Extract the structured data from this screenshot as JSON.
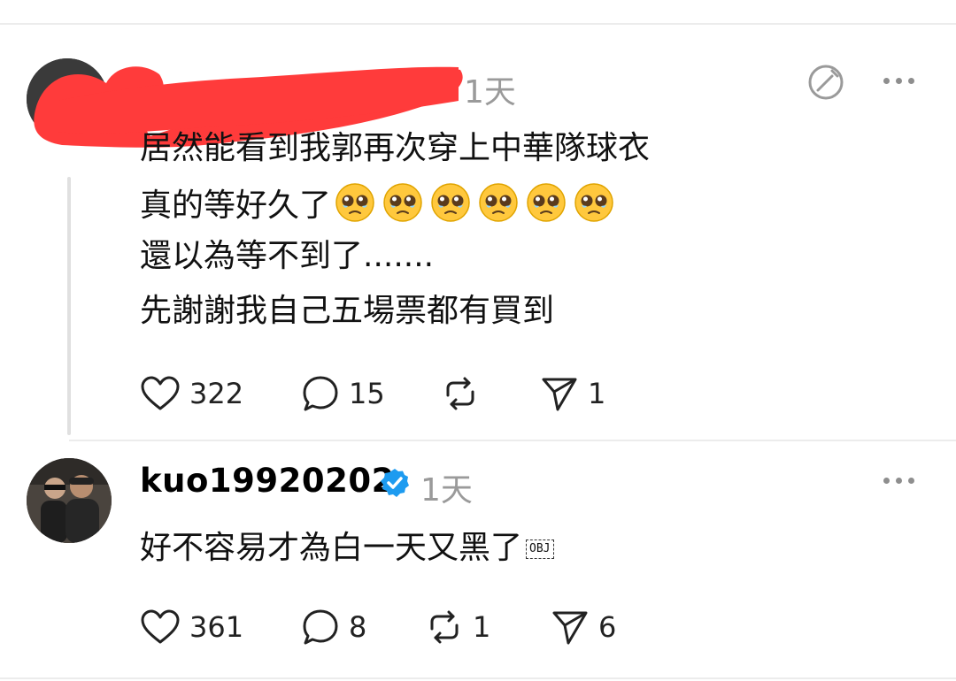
{
  "post1": {
    "timestamp": "1天",
    "lines": [
      "居然能看到我郭再次穿上中華隊球衣",
      "真的等好久了",
      "還以為等不到了.......",
      "先謝謝我自己五場票都有買到"
    ],
    "emoji_count": 6,
    "likes": "322",
    "comments": "15",
    "shares": "1"
  },
  "post2": {
    "username": "kuo19920202",
    "timestamp": "1天",
    "text": "好不容易才為白一天又黑了",
    "obj_glyph": "OBJ",
    "likes": "361",
    "comments": "8",
    "reposts": "1",
    "shares": "6"
  }
}
